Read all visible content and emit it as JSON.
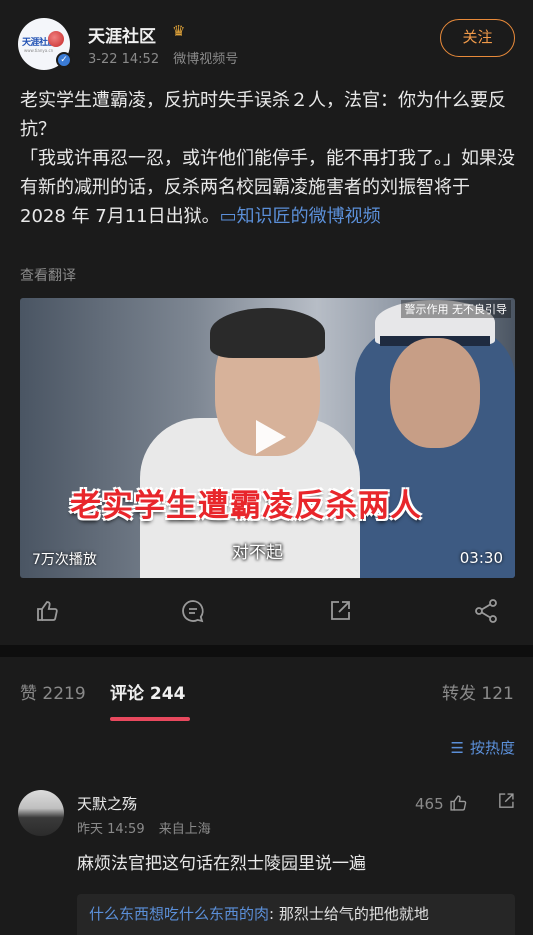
{
  "post": {
    "author": "天涯社区",
    "avatar_text": "天涯社区",
    "avatar_sub": "www.tianya.cn",
    "time": "3-22 14:52",
    "source": "微博视频号",
    "follow_label": "关注",
    "content_line1": "老实学生遭霸凌，反抗时失手误杀２人，法官：你为什么要反抗？",
    "content_line2": "「我或许再忍一忍，或许他们能停手，能不再打我了。」如果没有新的减刑的话，反杀两名校园霸凌施害者的刘振智将于 2028 年 7月11日出狱。",
    "link_text": "知识匠的微博视频",
    "translate_label": "查看翻译"
  },
  "video": {
    "warning": "警示作用 无不良引导",
    "caption_big": "老实学生遭霸凌反杀两人",
    "caption_small": "对不起",
    "plays": "7万次播放",
    "duration": "03:30"
  },
  "actions": {
    "like_icon": "thumb-up-icon",
    "comment_icon": "comment-icon",
    "repost_icon": "repost-icon",
    "share_icon": "share-icon"
  },
  "tabs": {
    "likes": "赞 2219",
    "comments": "评论 244",
    "reposts": "转发 121",
    "sort_label": "按热度"
  },
  "comment": {
    "name": "天默之殇",
    "time": "昨天 14:59",
    "location": "来自上海",
    "likes": "465",
    "text": "麻烦法官把这句话在烈士陵园里说一遍",
    "reply_name": "什么东西想吃什么东西的肉",
    "reply_text": ": 那烈士给气的把他就地"
  },
  "colors": {
    "background": "#1b1b1b",
    "accent_orange": "#f09a4a",
    "link_blue": "#5b8fd8",
    "tab_indicator": "#e8495e"
  }
}
